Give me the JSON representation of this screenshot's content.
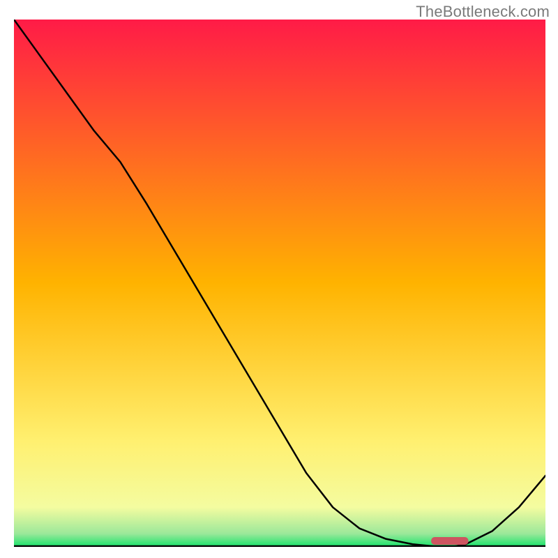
{
  "watermark": "TheBottleneck.com",
  "chart_data": {
    "type": "line",
    "x": [
      0.0,
      0.05,
      0.1,
      0.15,
      0.2,
      0.25,
      0.3,
      0.35,
      0.4,
      0.45,
      0.5,
      0.55,
      0.6,
      0.65,
      0.7,
      0.75,
      0.8,
      0.825,
      0.85,
      0.9,
      0.95,
      1.0
    ],
    "values": [
      1.0,
      0.93,
      0.86,
      0.79,
      0.73,
      0.65,
      0.565,
      0.48,
      0.395,
      0.31,
      0.225,
      0.14,
      0.075,
      0.035,
      0.015,
      0.005,
      0.0,
      0.0,
      0.005,
      0.03,
      0.075,
      0.135
    ],
    "series": [
      {
        "name": "metric",
        "values": [
          1.0,
          0.93,
          0.86,
          0.79,
          0.73,
          0.65,
          0.565,
          0.48,
          0.395,
          0.31,
          0.225,
          0.14,
          0.075,
          0.035,
          0.015,
          0.005,
          0.0,
          0.0,
          0.005,
          0.03,
          0.075,
          0.135
        ]
      }
    ],
    "title": "",
    "xlabel": "",
    "ylabel": "",
    "xlim": [
      0,
      1
    ],
    "ylim": [
      0,
      1
    ],
    "baseline_marker": {
      "x_start": 0.785,
      "x_end": 0.855,
      "color": "#cd5560"
    },
    "background_gradient": {
      "stops": [
        {
          "offset": 0.0,
          "color": "#ff1b47"
        },
        {
          "offset": 0.5,
          "color": "#ffb300"
        },
        {
          "offset": 0.8,
          "color": "#fff070"
        },
        {
          "offset": 0.925,
          "color": "#f4fca0"
        },
        {
          "offset": 0.975,
          "color": "#9be89a"
        },
        {
          "offset": 1.0,
          "color": "#17e36a"
        }
      ]
    },
    "line_color": "#000000",
    "baseline_color": "#000000"
  }
}
